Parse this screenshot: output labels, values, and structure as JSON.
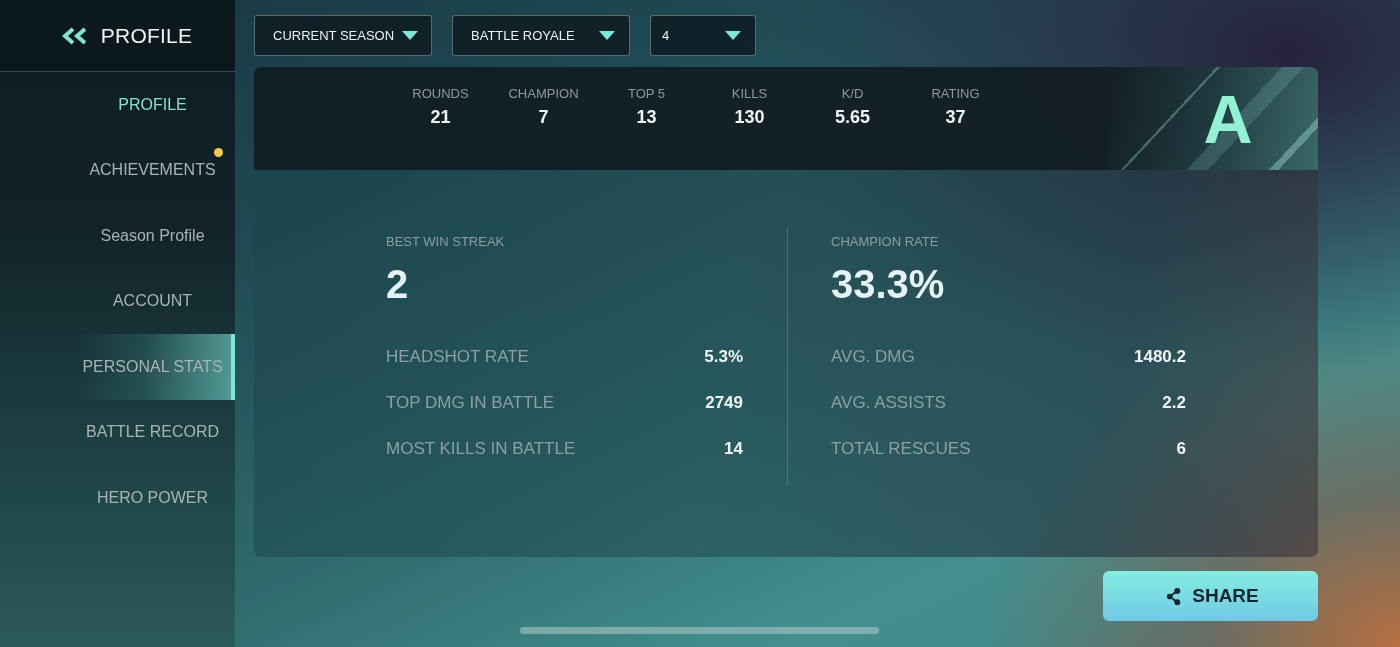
{
  "sidebar": {
    "title": "PROFILE",
    "items": [
      {
        "label": "PROFILE",
        "kind": "title",
        "selected": false,
        "notification": false
      },
      {
        "label": "ACHIEVEMENTS",
        "kind": "link",
        "selected": false,
        "notification": true
      },
      {
        "label": "Season Profile",
        "kind": "link",
        "selected": false,
        "notification": false
      },
      {
        "label": "ACCOUNT",
        "kind": "link",
        "selected": false,
        "notification": false
      },
      {
        "label": "PERSONAL STATS",
        "kind": "link",
        "selected": true,
        "notification": false
      },
      {
        "label": "BATTLE RECORD",
        "kind": "link",
        "selected": false,
        "notification": false
      },
      {
        "label": "HERO POWER",
        "kind": "link",
        "selected": false,
        "notification": false
      }
    ]
  },
  "filters": [
    {
      "value": "CURRENT SEASON"
    },
    {
      "value": "BATTLE ROYALE"
    },
    {
      "value": "4"
    }
  ],
  "summary": {
    "stats": [
      {
        "label": "ROUNDS",
        "value": "21"
      },
      {
        "label": "CHAMPION",
        "value": "7"
      },
      {
        "label": "TOP 5",
        "value": "13"
      },
      {
        "label": "KILLS",
        "value": "130"
      },
      {
        "label": "K/D",
        "value": "5.65"
      },
      {
        "label": "RATING",
        "value": "37"
      }
    ],
    "rank": "A"
  },
  "details": {
    "columns": [
      {
        "highlight": {
          "label": "BEST WIN STREAK",
          "value": "2"
        },
        "rows": [
          {
            "label": "HEADSHOT RATE",
            "value": "5.3%"
          },
          {
            "label": "TOP DMG IN BATTLE",
            "value": "2749"
          },
          {
            "label": "MOST KILLS IN BATTLE",
            "value": "14"
          }
        ]
      },
      {
        "highlight": {
          "label": "CHAMPION RATE",
          "value": "33.3%"
        },
        "rows": [
          {
            "label": "AVG. DMG",
            "value": "1480.2"
          },
          {
            "label": "AVG. ASSISTS",
            "value": "2.2"
          },
          {
            "label": "TOTAL RESCUES",
            "value": "6"
          }
        ]
      }
    ]
  },
  "share_button": {
    "label": "SHARE"
  }
}
